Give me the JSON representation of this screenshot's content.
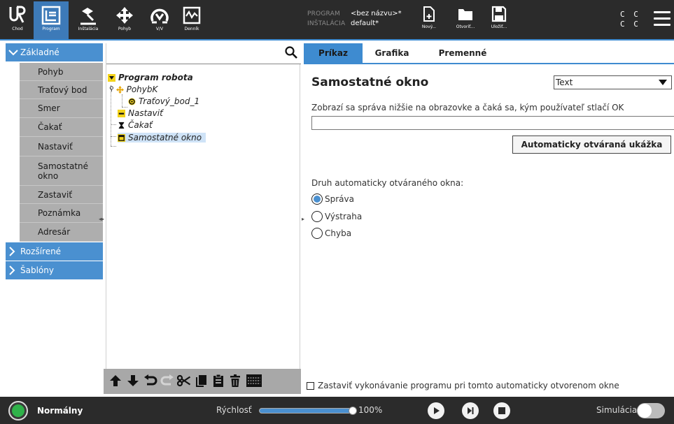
{
  "topbar": {
    "nav": [
      {
        "label": "Chod",
        "icon": "ur-logo-icon"
      },
      {
        "label": "Program",
        "icon": "program-icon",
        "active": true
      },
      {
        "label": "Inštalácia",
        "icon": "installation-icon"
      },
      {
        "label": "Pohyb",
        "icon": "move-icon"
      },
      {
        "label": "V/V",
        "icon": "io-icon"
      },
      {
        "label": "Denník",
        "icon": "log-icon"
      }
    ],
    "program_key": "PROGRAM",
    "program_value": "<bez názvu>*",
    "installation_key": "INŠTALÁCIA",
    "installation_value": "default*",
    "file_buttons": [
      {
        "label": "Nový...",
        "icon": "new-file-icon"
      },
      {
        "label": "Otvoriť...",
        "icon": "open-folder-icon"
      },
      {
        "label": "Uložiť...",
        "icon": "save-icon"
      }
    ],
    "cc_line1": "C C",
    "cc_line2": "C C",
    "accent_color": "#3e8bd0"
  },
  "left_panel": {
    "categories": [
      {
        "label": "Základné",
        "expanded": true
      },
      {
        "label": "Rozšírené",
        "expanded": false
      },
      {
        "label": "Šablóny",
        "expanded": false
      }
    ],
    "commands": [
      "Pohyb",
      "Traťový bod",
      "Smer",
      "Čakať",
      "Nastaviť",
      "Samostatné okno",
      "Zastaviť",
      "Poznámka",
      "Adresár"
    ]
  },
  "tree": {
    "search_placeholder": "",
    "nodes": [
      {
        "label": "Program robota",
        "icon": "collapse-triangle-icon"
      },
      {
        "label": "PohybK",
        "icon": "move-cross-icon"
      },
      {
        "label": "Traťový_bod_1",
        "icon": "waypoint-icon"
      },
      {
        "label": "Nastaviť",
        "icon": "set-icon"
      },
      {
        "label": "Čakať",
        "icon": "hourglass-icon"
      },
      {
        "label": "Samostatné okno",
        "icon": "popup-window-icon",
        "selected": true
      }
    ],
    "toolbar_icons": [
      "move-up-icon",
      "move-down-icon",
      "undo-icon",
      "redo-icon",
      "cut-icon",
      "copy-icon",
      "paste-icon",
      "delete-icon",
      "suppress-icon"
    ]
  },
  "right_panel": {
    "tabs": [
      "Príkaz",
      "Grafika",
      "Premenné"
    ],
    "active_tab": "Príkaz",
    "title": "Samostatné okno",
    "type_select_value": "Text",
    "description": "Zobrazí sa správa nižšie na obrazovke a čaká sa, kým používateľ stlačí OK",
    "message_value": "",
    "preview_button": "Automaticky otváraná ukážka",
    "kind_label": "Druh automaticky otváraného okna:",
    "kind_options": [
      "Správa",
      "Výstraha",
      "Chyba"
    ],
    "kind_selected": "Správa",
    "stop_checkbox_label": "Zastaviť vykonávanie programu pri tomto automaticky otvorenom okne",
    "stop_checked": false
  },
  "bottombar": {
    "status": "Normálny",
    "status_color": "#2fb24a",
    "speed_label": "Rýchlosť",
    "speed_value": "100%",
    "speed_fraction": 1.0,
    "simulation_label": "Simulácia",
    "simulation_on": false
  }
}
